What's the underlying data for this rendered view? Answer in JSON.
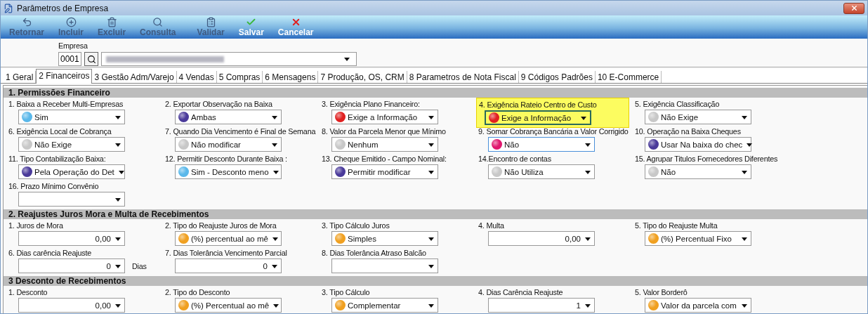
{
  "window": {
    "title": "Parâmetros de Empresa"
  },
  "toolbar": [
    {
      "label": "Retornar",
      "disabled": true
    },
    {
      "label": "Incluir",
      "disabled": true
    },
    {
      "label": "Excluir",
      "disabled": true
    },
    {
      "label": "Consulta",
      "disabled": true
    },
    {
      "label": "Validar",
      "disabled": true
    },
    {
      "label": "Salvar",
      "disabled": false
    },
    {
      "label": "Cancelar",
      "disabled": false
    }
  ],
  "company": {
    "label": "Empresa",
    "code": "0001"
  },
  "tabs": [
    {
      "label": "1 Geral",
      "selected": false
    },
    {
      "label": "2 Financeiros",
      "selected": true
    },
    {
      "label": "3 Gestão Adm/Varejo",
      "selected": false
    },
    {
      "label": "4 Vendas",
      "selected": false
    },
    {
      "label": "5 Compras",
      "selected": false
    },
    {
      "label": "6 Mensagens",
      "selected": false
    },
    {
      "label": "7 Produção, OS, CRM",
      "selected": false
    },
    {
      "label": "8 Parametros de Nota Fiscal",
      "selected": false
    },
    {
      "label": "9 Códigos Padrões",
      "selected": false
    },
    {
      "label": "10 E-Commerce",
      "selected": false
    }
  ],
  "sections": [
    {
      "title": "1.  Permissões Financeiro",
      "rows": [
        [
          {
            "label": "1. Baixa a Receber Multi-Empresas",
            "kind": "combo",
            "value": "Sim",
            "color": "#5ab8ea"
          },
          {
            "label": "2. Exportar Observação na Baixa",
            "kind": "combo",
            "value": "Ambas",
            "color": "#4a3a9a"
          },
          {
            "label": "3. Exigência Plano Financeiro:",
            "kind": "combo",
            "value": "Exige a Informação",
            "color": "#e02020"
          },
          {
            "label": "4. Exigência Rateio Centro de Custo",
            "kind": "combo",
            "value": "Exige a Informação",
            "color": "#e02020",
            "highlighted": true
          },
          {
            "label": "5. Exigência Classificação",
            "kind": "combo",
            "value": "Não Exige",
            "color": "#c8c8c8"
          }
        ],
        [
          {
            "label": "6. Exigência Local de Cobrança",
            "kind": "combo",
            "value": "Não Exige",
            "color": "#c8c8c8"
          },
          {
            "label": "7. Quando Dia Vencimento é Final de Semana",
            "kind": "combo",
            "value": "Não modificar",
            "color": "#c8c8c8"
          },
          {
            "label": "8. Valor da Parcela Menor que Mínimo",
            "kind": "combo",
            "value": "Nenhum",
            "color": "#c8c8c8"
          },
          {
            "label": "9. Somar Cobrança Bancária a Valor Corrigido",
            "kind": "combo",
            "value": "Não",
            "color": "#e0186e",
            "focused": true
          },
          {
            "label": "10. Operação na Baixa Cheques",
            "kind": "combo",
            "value": "Usar Na baixa do chec",
            "color": "#4a3a9a"
          }
        ],
        [
          {
            "label": "11. Tipo Contabilização Baixa:",
            "kind": "combo",
            "value": "Pela Operação do Det",
            "color": "#4a3a9a"
          },
          {
            "label": "12. Permitir Desconto Durante Baixa :",
            "kind": "combo",
            "value": "Sim - Desconto meno",
            "color": "#5ab8ea"
          },
          {
            "label": "13. Cheque Emitido - Campo Nominal:",
            "kind": "combo",
            "value": "Permitir modificar",
            "color": "#4a3a9a"
          },
          {
            "label": "14.Encontro de contas",
            "kind": "combo",
            "value": "Não Utiliza",
            "color": "#c8c8c8"
          },
          {
            "label": "15. Agrupar Titulos Fornecedores Diferentes",
            "kind": "combo",
            "value": "Não",
            "color": "#c8c8c8"
          }
        ],
        [
          {
            "label": "16. Prazo Mínimo Convênio",
            "kind": "combo"
          }
        ]
      ]
    },
    {
      "title": "2. Reajustes Juros Mora e Multa de Recebimentos",
      "rows": [
        [
          {
            "label": "1. Juros de Mora",
            "kind": "number",
            "value": "0,00"
          },
          {
            "label": "2. Tipo do Reajuste Juros de Mora",
            "kind": "combo",
            "value": "(%) percentual ao mê",
            "color": "#f0a020"
          },
          {
            "label": "3. Tipo Cálculo Juros",
            "kind": "combo",
            "value": "Simples",
            "color": "#f0a020"
          },
          {
            "label": "4. Multa",
            "kind": "number",
            "value": "0,00"
          },
          {
            "label": "5. Tipo do Reajuste Multa",
            "kind": "combo",
            "value": "(%) Percentual Fixo",
            "color": "#f0a020"
          }
        ],
        [
          {
            "label": "6. Dias carência Reajuste",
            "kind": "number",
            "value": "0",
            "suffix": "Dias"
          },
          {
            "label": "7. Dias Tolerância Vencimento Parcial",
            "kind": "number",
            "value": "0"
          },
          {
            "label": "8. Dias Tolerância Atraso Balcão",
            "kind": "combo"
          }
        ]
      ]
    },
    {
      "title": "3 Desconto de Recebimentos",
      "rows": [
        [
          {
            "label": "1. Desconto",
            "kind": "number",
            "value": "0,00"
          },
          {
            "label": "2. Tipo do Desconto",
            "kind": "combo",
            "value": "(%) Percentual ao mê",
            "color": "#f0a020"
          },
          {
            "label": "3. Tipo Cálculo",
            "kind": "combo",
            "value": "Complementar",
            "color": "#f0a020"
          },
          {
            "label": "4. Dias Carência Reajuste",
            "kind": "number",
            "value": "1"
          },
          {
            "label": "5. Valor Borderô",
            "kind": "combo",
            "value": "Valor da parcela com",
            "color": "#f0a020"
          }
        ]
      ]
    }
  ]
}
